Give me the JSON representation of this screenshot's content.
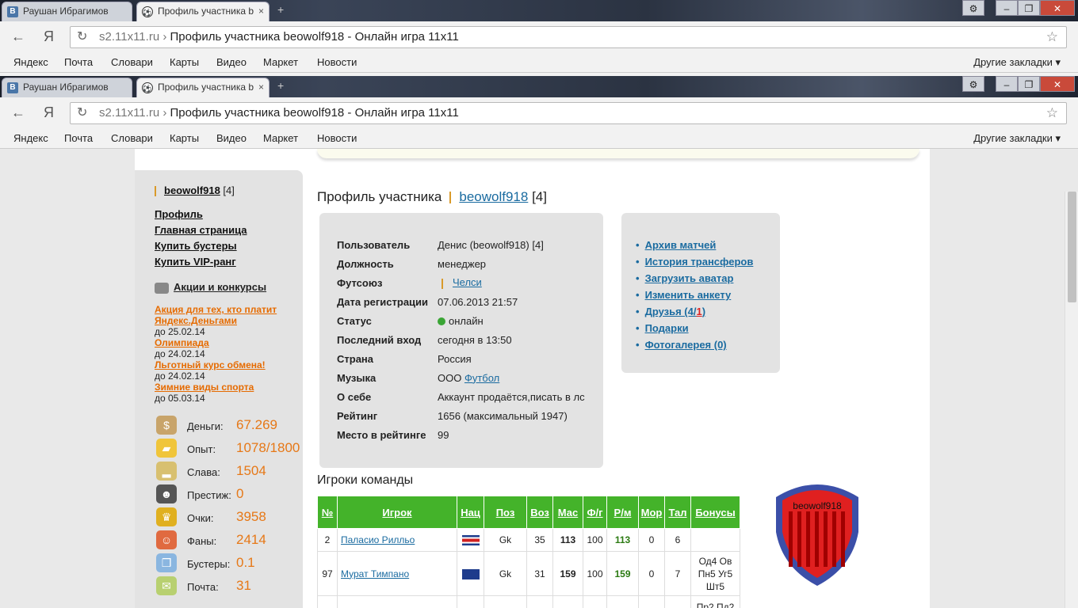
{
  "browser": {
    "tabs": [
      {
        "title": "Раушан Ибрагимов",
        "active": false,
        "icon": "vk-icon",
        "icon_text": "В"
      },
      {
        "title": "Профиль участника b",
        "active": true,
        "icon": "football-icon",
        "icon_text": "⚽"
      }
    ],
    "close_glyph": "×",
    "newtab_glyph": "+",
    "window": {
      "gear": "⚙",
      "minimize": "–",
      "maximize": "❐",
      "close": "✕"
    },
    "nav": {
      "back": "←",
      "yandex": "Я",
      "reload": "↻",
      "star": "☆"
    },
    "address": {
      "domain": "s2.11x11.ru",
      "separator": " › ",
      "title": "Профиль участника beowolf918 - Онлайн игра 11x11"
    },
    "bookmarks": [
      "Яндекс",
      "Почта",
      "Словари",
      "Карты",
      "Видео",
      "Маркет",
      "Новости"
    ],
    "other_bookmarks": "Другие закладки ▾"
  },
  "sidebar": {
    "username": "beowolf918",
    "level": "[4]",
    "links": [
      "Профиль",
      "Главная страница",
      "Купить бустеры",
      "Купить VIP-ранг"
    ],
    "promo": "Акции и конкурсы",
    "events": [
      {
        "title": "Акция для тех, кто платит Яндекс.Деньгами",
        "until": "до 25.02.14"
      },
      {
        "title": "Олимпиада",
        "until": "до 24.02.14"
      },
      {
        "title": "Льготный курс обмена!",
        "until": "до 24.02.14"
      },
      {
        "title": "Зимние виды спорта",
        "until": "до 05.03.14"
      }
    ],
    "stats": [
      {
        "label": "Деньги:",
        "value": "67.269",
        "icon": "money-bag-icon",
        "glyph": "$",
        "color": "#c8a46a"
      },
      {
        "label": "Опыт:",
        "value": "1078/1800",
        "icon": "cheese-icon",
        "glyph": "▰",
        "color": "#f0c53a"
      },
      {
        "label": "Слава:",
        "value": "1504",
        "icon": "podium-icon",
        "glyph": "▂",
        "color": "#d8c070"
      },
      {
        "label": "Престиж:",
        "value": "0",
        "icon": "butler-icon",
        "glyph": "☻",
        "color": "#555"
      },
      {
        "label": "Очки:",
        "value": "3958",
        "icon": "trophy-icon",
        "glyph": "♛",
        "color": "#e0b020"
      },
      {
        "label": "Фаны:",
        "value": "2414",
        "icon": "fans-icon",
        "glyph": "☺",
        "color": "#e06a40"
      },
      {
        "label": "Бустеры:",
        "value": "0.1",
        "icon": "gift-icon",
        "glyph": "❒",
        "color": "#8ab6e0"
      },
      {
        "label": "Почта:",
        "value": "31",
        "icon": "mail-icon",
        "glyph": "✉",
        "color": "#b8d070"
      }
    ]
  },
  "profile": {
    "heading": "Профиль участника",
    "username": "beowolf918",
    "level": "[4]",
    "fields": [
      {
        "k": "Пользователь",
        "v": "Денис (beowolf918) [4]"
      },
      {
        "k": "Должность",
        "v": "менеджер"
      },
      {
        "k": "Футсоюз",
        "v": "",
        "link": "Челси"
      },
      {
        "k": "Дата регистрации",
        "v": "07.06.2013 21:57"
      },
      {
        "k": "Статус",
        "v": "онлайн"
      },
      {
        "k": "Последний вход",
        "v": "сегодня в 13:50"
      },
      {
        "k": "Страна",
        "v": "Россия"
      },
      {
        "k": "Музыка",
        "v": "ООО ",
        "link": "Футбол"
      },
      {
        "k": "О себе",
        "v": "Аккаунт продаётся,писать в лс"
      },
      {
        "k": "Рейтинг",
        "v": "1656 (максимальный 1947)"
      },
      {
        "k": "Место в рейтинге",
        "v": "99"
      }
    ]
  },
  "links": {
    "items": [
      "Архив матчей",
      "История трансферов",
      "Загрузить аватар",
      "Изменить анкету"
    ],
    "friends": {
      "prefix": "Друзья (4/",
      "red": "1",
      "suffix": ")"
    },
    "items2": [
      "Подарки",
      "Фотогалерея (0)"
    ]
  },
  "players": {
    "heading": "Игроки команды",
    "headers": [
      "№",
      "Игрок",
      "Нац",
      "Поз",
      "Воз",
      "Мас",
      "Ф/г",
      "Р/м",
      "Мор",
      "Тал",
      "Бонусы"
    ],
    "rows": [
      {
        "num": "2",
        "name": "Паласио Рилльо",
        "flag": "costa-rica",
        "pos": "Gk",
        "age": "35",
        "mas": "113",
        "fg": "100",
        "rm": "113",
        "mor": "0",
        "tal": "6",
        "bonus": ""
      },
      {
        "num": "97",
        "name": "Мурат Тимпано",
        "flag": "australia",
        "pos": "Gk",
        "age": "31",
        "mas": "159",
        "fg": "100",
        "rm": "159",
        "mor": "0",
        "tal": "7",
        "bonus": "Од4 Ов Пн5 Уг5 Шт5"
      },
      {
        "num": "",
        "name": "",
        "flag": "",
        "pos": "",
        "age": "",
        "mas": "",
        "fg": "",
        "rm": "",
        "mor": "",
        "tal": "",
        "bonus": "Пр2 Пд2"
      }
    ]
  },
  "crest": {
    "text": "beowolf918",
    "colors": {
      "outer": "#3b4fa8",
      "inner": "#e02020",
      "stripe": "#b00000"
    }
  }
}
